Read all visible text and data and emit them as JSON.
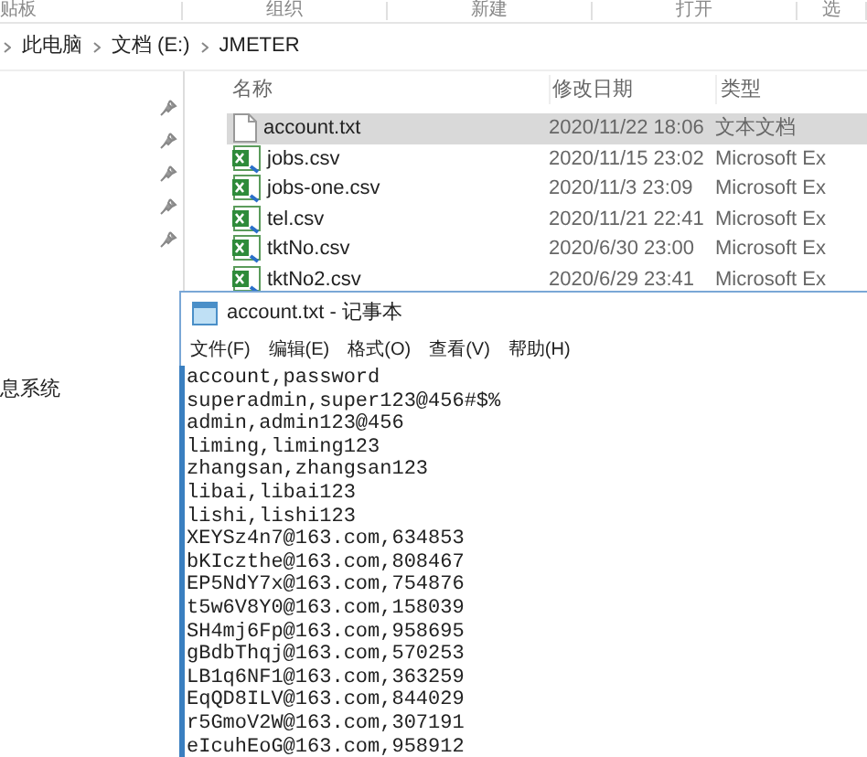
{
  "ribbon": {
    "groups": [
      "贴板",
      "组织",
      "新建",
      "打开",
      "选"
    ]
  },
  "breadcrumb": [
    "此电脑",
    "文档 (E:)",
    "JMETER"
  ],
  "sidebar": {
    "items": [
      {
        "label": "息系统"
      }
    ]
  },
  "file_list": {
    "columns": [
      "名称",
      "修改日期",
      "类型"
    ],
    "rows": [
      {
        "name": "account.txt",
        "date": "2020/11/22 18:06",
        "type": "文本文档",
        "kind": "txt",
        "selected": true
      },
      {
        "name": "jobs.csv",
        "date": "2020/11/15 23:02",
        "type": "Microsoft Ex",
        "kind": "csv",
        "selected": false
      },
      {
        "name": "jobs-one.csv",
        "date": "2020/11/3 23:09",
        "type": "Microsoft Ex",
        "kind": "csv",
        "selected": false
      },
      {
        "name": "tel.csv",
        "date": "2020/11/21 22:41",
        "type": "Microsoft Ex",
        "kind": "csv",
        "selected": false
      },
      {
        "name": "tktNo.csv",
        "date": "2020/6/30 23:00",
        "type": "Microsoft Ex",
        "kind": "csv",
        "selected": false
      },
      {
        "name": "tktNo2.csv",
        "date": "2020/6/29 23:41",
        "type": "Microsoft Ex",
        "kind": "csv",
        "selected": false
      }
    ]
  },
  "notepad": {
    "title": "account.txt - 记事本",
    "menu": [
      "文件(F)",
      "编辑(E)",
      "格式(O)",
      "查看(V)",
      "帮助(H)"
    ],
    "lines": [
      "account,password",
      "superadmin,super123@456#$%",
      "admin,admin123@456",
      "liming,liming123",
      "zhangsan,zhangsan123",
      "libai,libai123",
      "lishi,lishi123",
      "XEYSz4n7@163.com,634853",
      "bKIczthe@163.com,808467",
      "EP5NdY7x@163.com,754876",
      "t5w6V8Y0@163.com,158039",
      "SH4mj6Fp@163.com,958695",
      "gBdbThqj@163.com,570253",
      "LB1q6NF1@163.com,363259",
      "EqQD8ILV@163.com,844029",
      "r5GmoV2W@163.com,307191",
      "eIcuhEoG@163.com,958912"
    ]
  }
}
